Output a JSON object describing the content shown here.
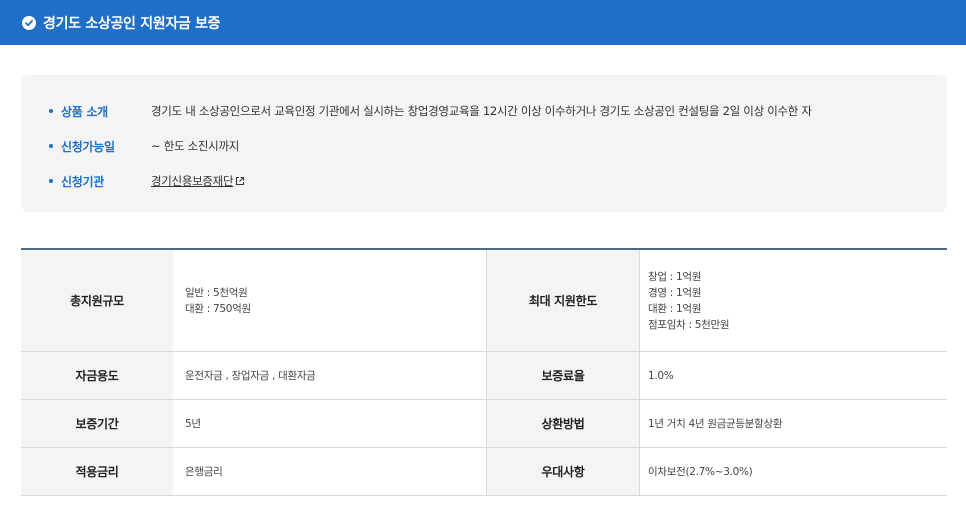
{
  "header": {
    "title": "경기도 소상공인 지원자금 보증",
    "icon": "check-circle-icon"
  },
  "info": {
    "items": [
      {
        "label": "상품 소개",
        "value": "경기도 내 소상공인으로서 교육인정 기관에서 실시하는 창업경영교육을 12시간 이상 이수하거나 경기도 소상공인 컨설팅을 2일 이상 이수한 자"
      },
      {
        "label": "신청가능일",
        "value": "~ 한도 소진시까지"
      },
      {
        "label": "신청기관",
        "value": "경기신용보증재단"
      }
    ]
  },
  "table": {
    "rows": [
      {
        "left_header": "총지원규모",
        "left_lines": [
          "일반 : 5천억원",
          "대환 : 750억원"
        ],
        "right_header": "최대 지원한도",
        "right_lines": [
          "창업 : 1억원",
          "경영 : 1억원",
          "대환 : 1억원",
          "점포임차 : 5천만원"
        ]
      },
      {
        "left_header": "자금용도",
        "left_lines": [
          "운전자금 , 창업자금 , 대환자금"
        ],
        "right_header": "보증료율",
        "right_lines": [
          "1.0%"
        ]
      },
      {
        "left_header": "보증기간",
        "left_lines": [
          "5년"
        ],
        "right_header": "상환방법",
        "right_lines": [
          "1년 거치 4년 원금균등분할상환"
        ]
      },
      {
        "left_header": "적용금리",
        "left_lines": [
          "은행금리"
        ],
        "right_header": "우대사항",
        "right_lines": [
          "이차보전(2.7%~3.0%)"
        ]
      }
    ]
  },
  "colors": {
    "brand": "#1f6fc6",
    "box_bg": "#f4f4f4",
    "table_top": "#4a6a88"
  }
}
